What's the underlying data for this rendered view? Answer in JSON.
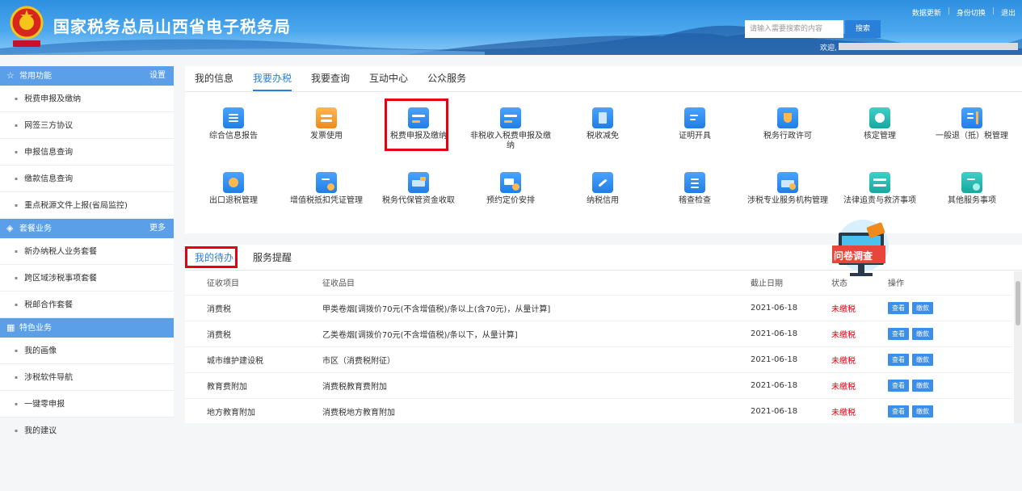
{
  "header": {
    "title": "国家税务总局山西省电子税务局",
    "search_placeholder": "请输入需要搜索的内容",
    "search_label": "搜索",
    "links": [
      "数据更新",
      "身份切换",
      "退出"
    ],
    "welcome": "欢迎,"
  },
  "sidebar": {
    "common": {
      "title": "常用功能",
      "action": "设置",
      "items": [
        "税费申报及缴纳",
        "网签三方协议",
        "申报信息查询",
        "缴款信息查询",
        "重点税源文件上报(省局监控)"
      ]
    },
    "package": {
      "title": "套餐业务",
      "action": "更多",
      "items": [
        "新办纳税人业务套餐",
        "跨区域涉税事项套餐",
        "税邮合作套餐"
      ]
    },
    "special": {
      "title": "特色业务",
      "items": [
        "我的画像",
        "涉税软件导航",
        "一键零申报"
      ]
    },
    "suggestion": "我的建议"
  },
  "main": {
    "tabs": [
      "我的信息",
      "我要办税",
      "我要查询",
      "互动中心",
      "公众服务"
    ],
    "active_tab": "我要办税",
    "tiles_row1": [
      "综合信息报告",
      "发票使用",
      "税费申报及缴纳",
      "非税收入税费申报及缴纳",
      "税收减免",
      "证明开具",
      "税务行政许可",
      "核定管理",
      "一般退（抵）税管理"
    ],
    "tiles_row2": [
      "出口退税管理",
      "增值税抵扣凭证管理",
      "税务代保管资金收取",
      "预约定价安排",
      "纳税信用",
      "稽查检查",
      "涉税专业服务机构管理",
      "法律追责与救济事项",
      "其他服务事项"
    ]
  },
  "todo": {
    "tabs": [
      "我的待办",
      "服务提醒"
    ],
    "columns": [
      "征收项目",
      "征收品目",
      "截止日期",
      "状态",
      "操作"
    ],
    "rows": [
      [
        "消费税",
        "甲类卷烟[调拨价70元(不含增值税)/条以上(含70元)，从量计算]",
        "2021-06-18",
        "未缴税"
      ],
      [
        "消费税",
        "乙类卷烟[调拨价70元(不含增值税)/条以下，从量计算]",
        "2021-06-18",
        "未缴税"
      ],
      [
        "城市维护建设税",
        "市区（消费税附征）",
        "2021-06-18",
        "未缴税"
      ],
      [
        "教育费附加",
        "消费税教育费附加",
        "2021-06-18",
        "未缴税"
      ],
      [
        "地方教育附加",
        "消费税地方教育附加",
        "2021-06-18",
        "未缴税"
      ]
    ],
    "view_label": "查看",
    "pay_label": "缴款"
  },
  "survey": {
    "label": "问卷调查"
  },
  "colors": {
    "primary": "#2a7fd8",
    "sidebar_head": "#5b9fe8",
    "highlight": "#e60012",
    "status": "#e60012"
  }
}
